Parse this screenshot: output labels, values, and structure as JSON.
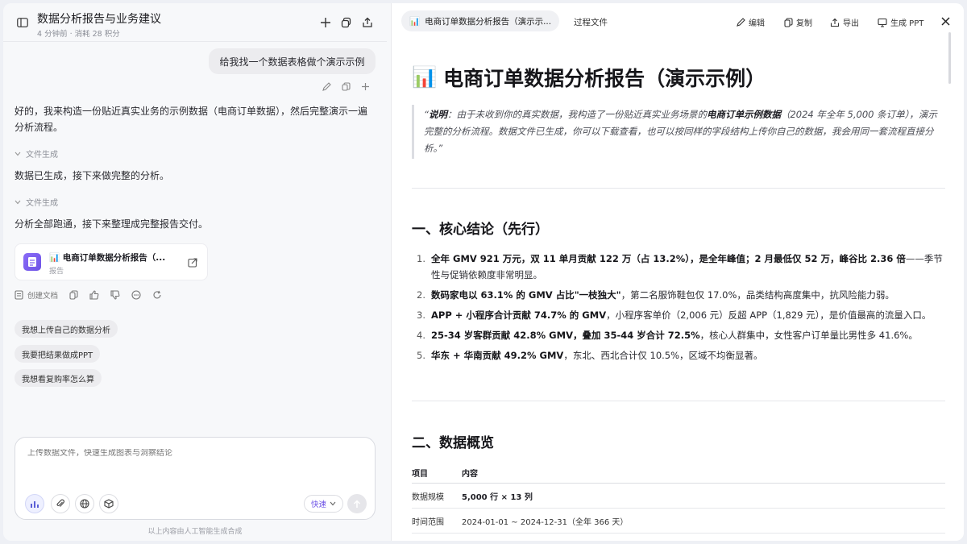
{
  "left": {
    "title": "数据分析报告与业务建议",
    "subtitle": "4 分钟前 · 消耗 28 积分",
    "user_message": "给我找一个数据表格做个演示示例",
    "reply_1": "好的，我来构造一份贴近真实业务的示例数据（电商订单数据），然后完整演示一遍分析流程。",
    "fold_1": "文件生成",
    "reply_2": "数据已生成，接下来做完整的分析。",
    "fold_2": "文件生成",
    "reply_3": "分析全部跑通，接下来整理成完整报告交付。",
    "file_card": {
      "emoji": "📊",
      "title": "电商订单数据分析报告（...",
      "tag": "报告"
    },
    "create_doc_label": "创建文档",
    "suggestions": [
      "我想上传自己的数据分析",
      "我要把结果做成PPT",
      "我想看复购率怎么算"
    ],
    "input_placeholder": "上传数据文件，快速生成图表与洞察结论",
    "speed_label": "快速",
    "footnote": "以上内容由人工智能生成合成"
  },
  "right": {
    "active_tab": "电商订单数据分析报告（演示示...",
    "active_tab_emoji": "📊",
    "tab_2": "过程文件",
    "toolbar": {
      "edit": "编辑",
      "copy": "复制",
      "export": "导出",
      "ppt": "生成 PPT"
    },
    "doc": {
      "emoji": "📊",
      "title": "电商订单数据分析报告（演示示例）",
      "quote_label": "说明",
      "quote_pre": "：由于未收到你的真实数据，我构造了一份贴近真实业务场景的",
      "quote_bold": "电商订单示例数据",
      "quote_post": "（2024 年全年 5,000 条订单），演示完整的分析流程。数据文件已生成，你可以下载查看，也可以按同样的字段结构上传你自己的数据，我会用同一套流程直接分析。”",
      "quote_open": "“",
      "section1": "一、核心结论（先行）",
      "findings": [
        {
          "num": "1.",
          "bold": "全年 GMV 921 万元，双 11 单月贡献 122 万（占 13.2%），是全年峰值；2 月最低仅 52 万，峰谷比 2.36 倍",
          "rest": "——季节性与促销依赖度非常明显。"
        },
        {
          "num": "2.",
          "bold": "数码家电以 63.1% 的 GMV 占比\"一枝独大\"",
          "rest": "，第二名服饰鞋包仅 17.0%，品类结构高度集中，抗风险能力弱。"
        },
        {
          "num": "3.",
          "bold": "APP + 小程序合计贡献 74.7% 的 GMV",
          "rest": "，小程序客单价（2,006 元）反超 APP（1,829 元），是价值最高的流量入口。"
        },
        {
          "num": "4.",
          "bold": "25-34 岁客群贡献 42.8% GMV，叠加 35-44 岁合计 72.5%",
          "rest": "，核心人群集中，女性客户订单量比男性多 41.6%。"
        },
        {
          "num": "5.",
          "bold": "华东 + 华南贡献 49.2% GMV",
          "rest": "，东北、西北合计仅 10.5%，区域不均衡显著。"
        }
      ],
      "section2": "二、数据概览",
      "table": {
        "headers": [
          "项目",
          "内容"
        ],
        "rows": [
          [
            "数据规模",
            "5,000 行 × 13 列"
          ],
          [
            "时间范围",
            "2024-01-01 ~ 2024-12-31（全年 366 天）"
          ]
        ]
      }
    }
  }
}
